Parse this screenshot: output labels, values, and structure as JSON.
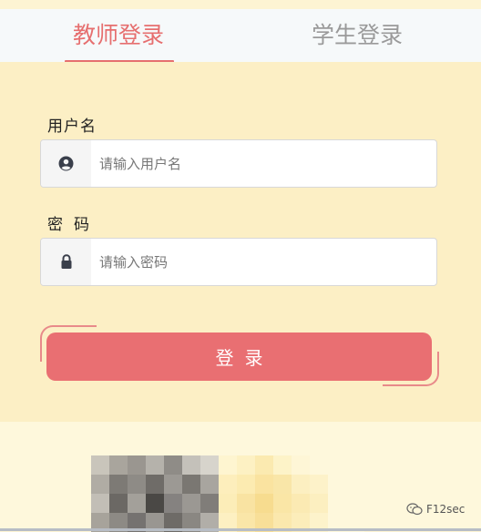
{
  "tabs": {
    "teacher": "教师登录",
    "student": "学生登录"
  },
  "form": {
    "username_label": "用户名",
    "username_placeholder": "请输入用户名",
    "password_label": "密码",
    "password_placeholder": "请输入密码",
    "login_button": "登录"
  },
  "watermark": {
    "text": "F12sec"
  },
  "icons": {
    "username": "user-circle-icon",
    "password": "lock-icon",
    "watermark": "wechat-icon"
  },
  "colors": {
    "accent": "#e96f72",
    "active_tab": "#e66f6f",
    "inactive_tab": "#9a9a9a",
    "panel_bg": "#fcefc5"
  }
}
